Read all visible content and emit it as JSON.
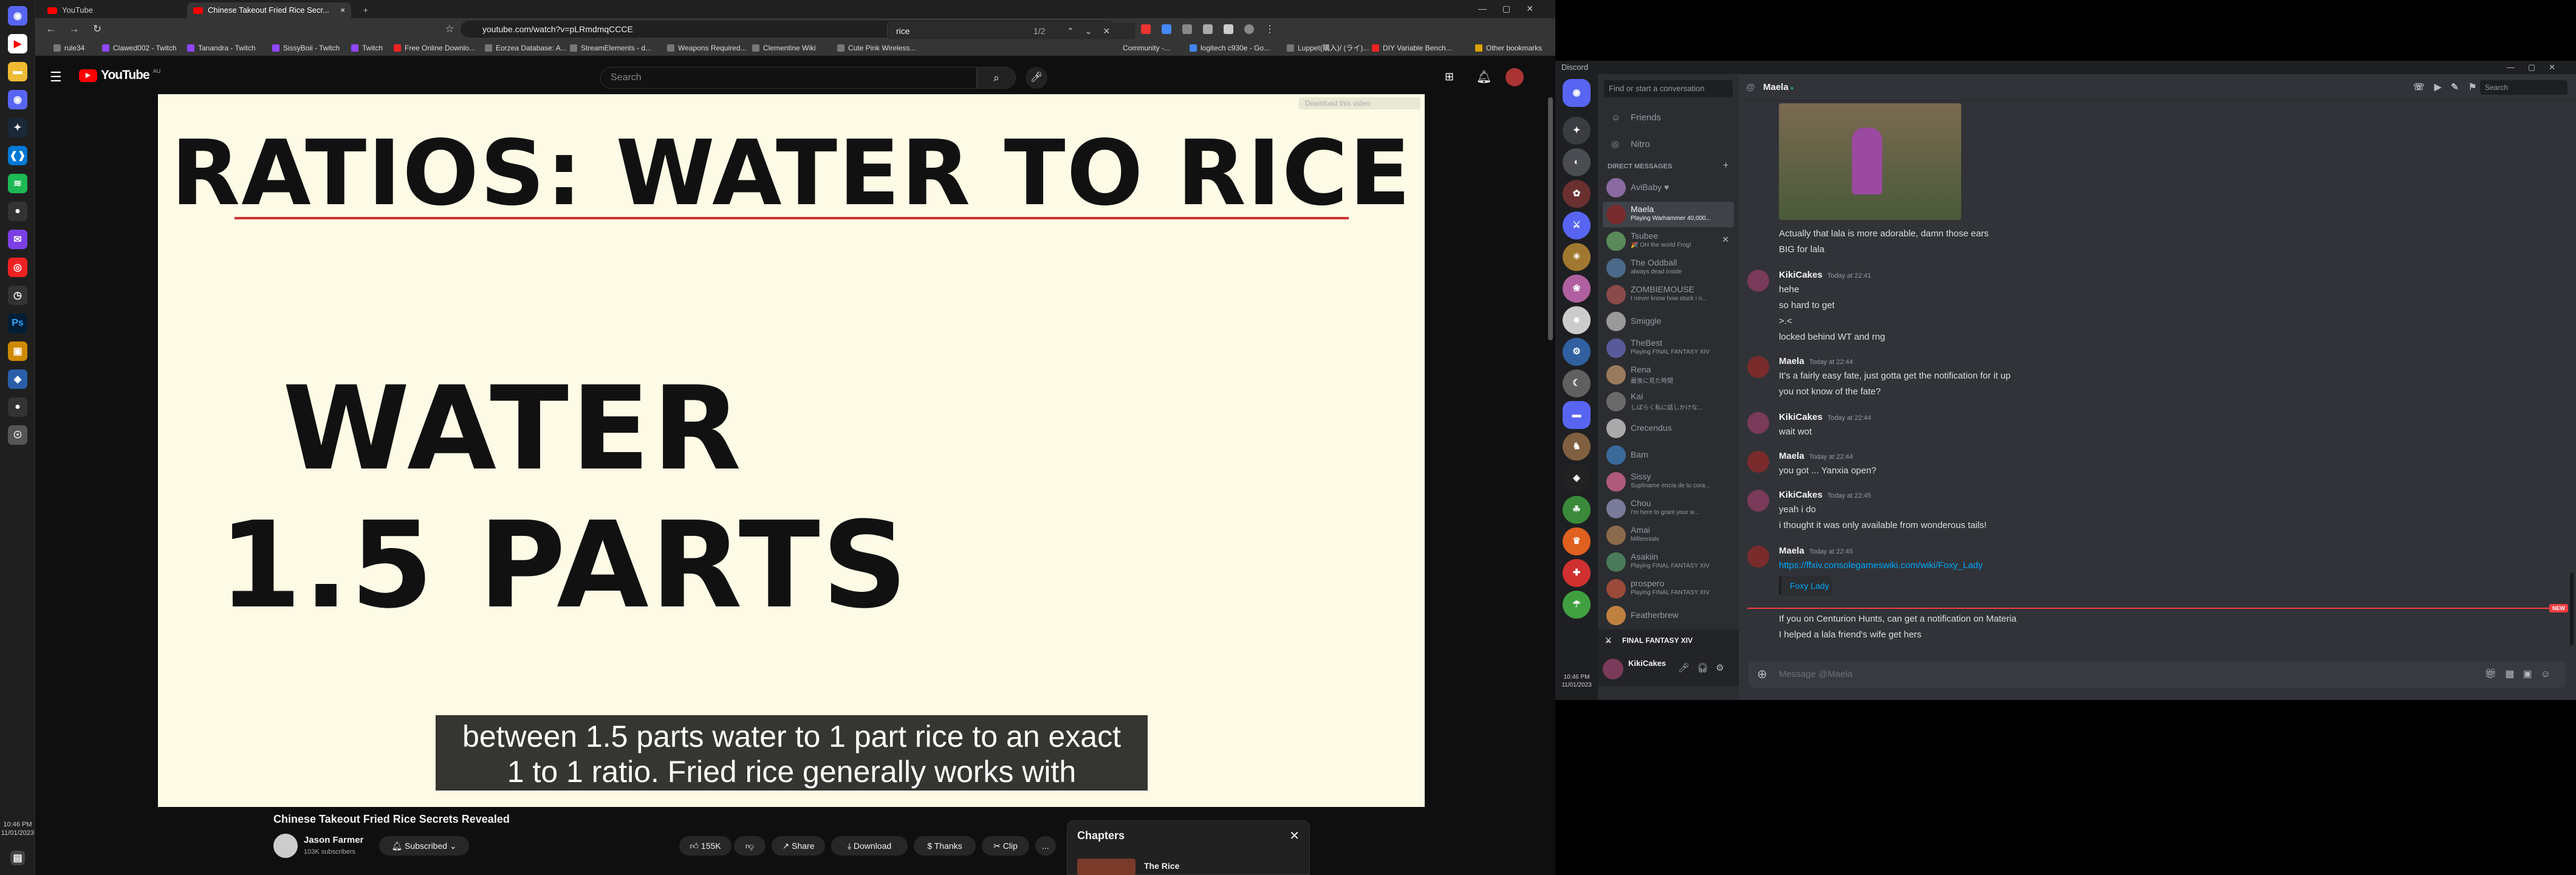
{
  "taskbar": {
    "time": "10:46 PM",
    "date": "11/01/2023",
    "icons": [
      "discord-icon",
      "youtube-icon",
      "steam-icon",
      "vscode-icon",
      "spotify-icon",
      "obs-icon",
      "messenger-icon",
      "app-icon",
      "clock-icon",
      "photoshop-icon",
      "folder-icon",
      "app2-icon",
      "app3-icon",
      "app4-icon"
    ]
  },
  "browser": {
    "tabs": [
      {
        "label": "YouTube"
      },
      {
        "label": "Chinese Takeout Fried Rice Secr..."
      }
    ],
    "url": "youtube.com/watch?v=pLRmdmqCCCE",
    "find": {
      "query": "rice",
      "count": "1/2"
    },
    "bookmarks": [
      "rule34",
      "Clawed002 - Twitch",
      "Tanandra - Twitch",
      "SissyBoii - Twitch",
      "Twitch",
      "Free Online Downlo...",
      "Eorzea Database: A...",
      "StreamElements - d...",
      "Weapons Required...",
      "Clementine Wiki",
      "Cute Pink Wireless...",
      "Community -...",
      "logitech c930e - Go...",
      "Luppet(購入)/ (ライ)...",
      "DIY Variable Bench...",
      "Other bookmarks"
    ]
  },
  "youtube": {
    "logo": "YouTube",
    "region": "AU",
    "search_placeholder": "Search",
    "slide": {
      "title": "RATIOS: WATER TO RICE",
      "line1": "WATER",
      "line2": "1.5 PARTS"
    },
    "subtitles": [
      "between 1.5 parts water to 1 part rice to an exact",
      "1 to 1 ratio. Fried rice generally works with"
    ],
    "download_chip": "Download this video",
    "video_title": "Chinese Takeout Fried Rice Secrets Revealed",
    "channel": "Jason Farmer",
    "subscribers": "103K subscribers",
    "subscribed": "Subscribed",
    "likes": "155K",
    "share": "Share",
    "download": "Download",
    "thanks": "Thanks",
    "clip": "Clip",
    "more": "...",
    "chapters_title": "Chapters",
    "chapter_first": "The Rice"
  },
  "discord": {
    "app_title": "Discord",
    "search_convo": "Find or start a conversation",
    "friends": "Friends",
    "nitro": "Nitro",
    "dm_header": "DIRECT MESSAGES",
    "channel_name": "Maela",
    "search_placeholder": "Search",
    "dms": [
      {
        "name": "AviBaby ♥",
        "sub": ""
      },
      {
        "name": "Maela",
        "sub": "Playing Warhammer 40,000..."
      },
      {
        "name": "Tsubee",
        "sub": "🎉 OH the world Frog!"
      },
      {
        "name": "The Oddball",
        "sub": "always dead inside"
      },
      {
        "name": "ZOMBIEMOUSE",
        "sub": "I never know how stuck i n..."
      },
      {
        "name": "Smiggle",
        "sub": ""
      },
      {
        "name": "TheBest",
        "sub": "Playing FINAL FANTASY XIV"
      },
      {
        "name": "Rena",
        "sub": "最後に見た時間"
      },
      {
        "name": "Kai",
        "sub": "しばらく私に話しかけな..."
      },
      {
        "name": "Crecendus",
        "sub": ""
      },
      {
        "name": "Bam",
        "sub": ""
      },
      {
        "name": "Sissy",
        "sub": "Suplíname encía de tu cora..."
      },
      {
        "name": "Chou",
        "sub": "I'm here to grant your w..."
      },
      {
        "name": "Amai",
        "sub": "Millennials"
      },
      {
        "name": "Asakiin",
        "sub": "Playing FINAL FANTASY XIV"
      },
      {
        "name": "prospero",
        "sub": "Playing FINAL FANTASY XIV"
      },
      {
        "name": "Featherbrew",
        "sub": ""
      }
    ],
    "game_activity": "FINAL FANTASY XIV",
    "user": {
      "name": "KikiCakes",
      "status": ""
    },
    "messages": [
      {
        "author": "",
        "time": "",
        "lines": [
          "Actually that lala is more adorable, damn those ears",
          "BIG for lala"
        ]
      },
      {
        "author": "KikiCakes",
        "time": "Today at 22:41",
        "lines": [
          "hehe",
          "so hard to get",
          ">.<",
          "locked behind WT and rng"
        ]
      },
      {
        "author": "Maela",
        "time": "Today at 22:44",
        "lines": [
          "It's a fairly easy fate, just gotta get the notification for it up",
          "you not know of the fate?"
        ]
      },
      {
        "author": "KikiCakes",
        "time": "Today at 22:44",
        "lines": [
          "wait wot"
        ]
      },
      {
        "author": "Maela",
        "time": "Today at 22:44",
        "lines": [
          "you got ... Yanxia open?"
        ]
      },
      {
        "author": "KikiCakes",
        "time": "Today at 22:45",
        "lines": [
          "yeah i do",
          "i thought it was only available from wonderous tails!"
        ]
      },
      {
        "author": "Maela",
        "time": "Today at 22:45",
        "lines": [
          "https://ffxiv.consolegameswiki.com/wiki/Foxy_Lady"
        ]
      },
      {
        "author": "",
        "time": "",
        "lines": [
          "If you on Centurion Hunts, can get a notification on Materia",
          "I helped a lala friend's wife get hers"
        ]
      }
    ],
    "embed_link": "Foxy Lady",
    "new_badge": "NEW",
    "input_placeholder": "Message @Maela",
    "clock_time": "10:46 PM",
    "clock_date": "11/01/2023"
  }
}
